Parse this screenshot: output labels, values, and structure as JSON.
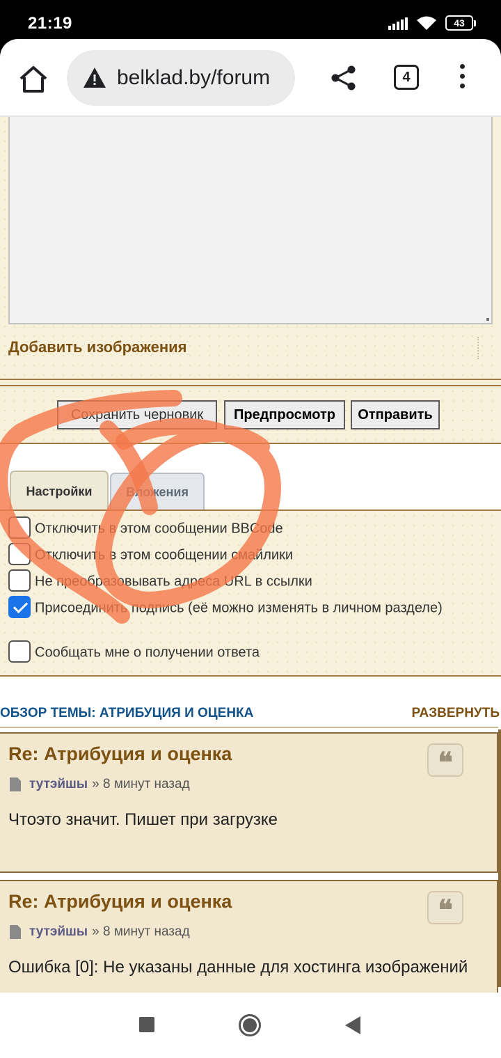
{
  "status_bar": {
    "time": "21:19",
    "battery": "43",
    "icons": [
      "signal-icon",
      "wifi-icon",
      "battery-icon"
    ]
  },
  "browser": {
    "url": "belklad.by/forum",
    "tab_count": "4",
    "icons": [
      "home-icon",
      "warning-icon",
      "share-icon",
      "tabs-icon",
      "more-vert-icon"
    ]
  },
  "editor": {
    "add_images": "Добавить изображения"
  },
  "buttons": {
    "save_draft": "Сохранить черновик",
    "preview": "Предпросмотр",
    "submit": "Отправить"
  },
  "tabs": [
    {
      "label": "Настройки",
      "active": true
    },
    {
      "label": "Вложения",
      "active": false
    }
  ],
  "options": [
    {
      "label": "Отключить в этом сообщении BBCode",
      "checked": false
    },
    {
      "label": "Отключить в этом сообщении смайлики",
      "checked": false
    },
    {
      "label": "Не преобразовывать адреса URL в ссылки",
      "checked": false
    },
    {
      "label": "Присоединить подпись (её можно изменять в личном разделе)",
      "checked": true
    },
    {
      "label": "Сообщать мне о получении ответа",
      "checked": false
    }
  ],
  "topic_review": {
    "title": "ОБЗОР ТЕМЫ: АТРИБУЦИЯ И ОЦЕНКА",
    "expand": "РАЗВЕРНУТЬ",
    "posts": [
      {
        "title": "Re: Атрибуция и оценка",
        "author": "тутэйшы",
        "time": "» 8 минут назад",
        "content": "Чтоэто значит. Пишет при загрузке"
      },
      {
        "title": "Re: Атрибуция и оценка",
        "author": "тутэйшы",
        "time": "» 8 минут назад",
        "content": "Ошибка [0]: Не указаны данные для хостинга изображений"
      }
    ]
  },
  "annotation_color": "#f4784a",
  "colors": {
    "link": "#105289",
    "accent_brown": "#7c5112",
    "checkbox_checked": "#1a73e8"
  }
}
